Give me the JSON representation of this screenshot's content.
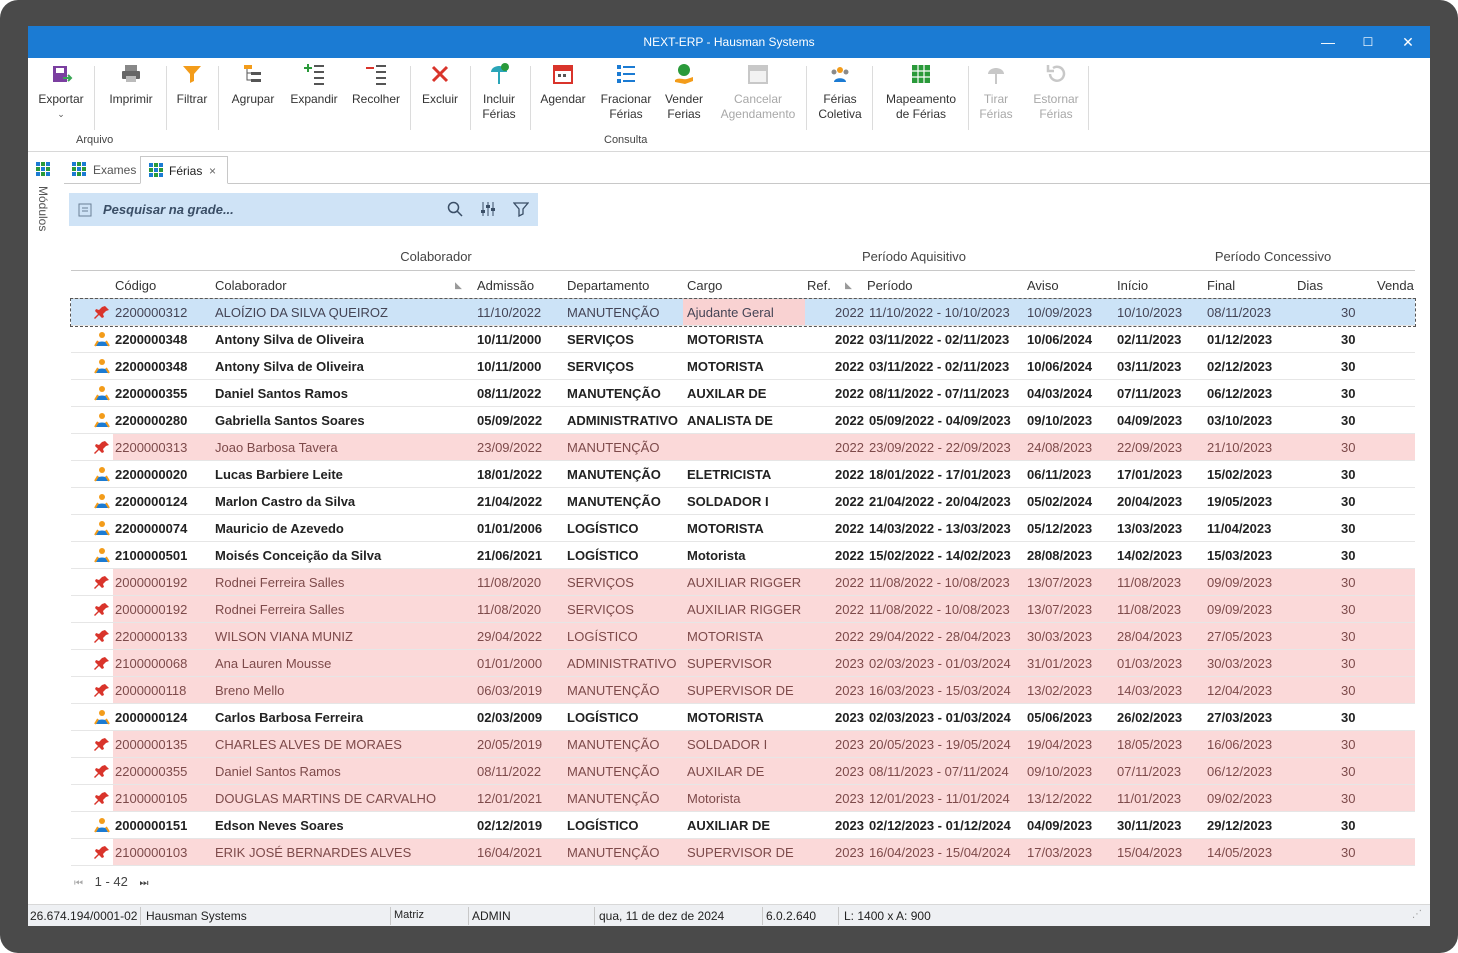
{
  "window": {
    "title": "NEXT-ERP - Hausman Systems",
    "minimize": "—",
    "maximize": "☐",
    "close": "✕"
  },
  "ribbon": {
    "exportar": "Exportar",
    "imprimir": "Imprimir",
    "filtrar": "Filtrar",
    "agrupar": "Agrupar",
    "expandir": "Expandir",
    "recolher": "Recolher",
    "excluir": "Excluir",
    "incluir_ferias": [
      "Incluir",
      "Férias"
    ],
    "agendar": "Agendar",
    "fracionar_ferias": [
      "Fracionar",
      "Férias"
    ],
    "vender_ferias": [
      "Vender",
      "Ferias"
    ],
    "cancelar_agendamento": [
      "Cancelar",
      "Agendamento"
    ],
    "ferias_coletiva": [
      "Férias",
      "Coletiva"
    ],
    "mapeamento_ferias": [
      "Mapeamento",
      "de Férias"
    ],
    "tirar_ferias": [
      "Tirar",
      "Férias"
    ],
    "estornar_ferias": [
      "Estornar",
      "Férias"
    ],
    "group_arquivo": "Arquivo",
    "group_consulta": "Consulta"
  },
  "sidebar": {
    "label": "Módulos"
  },
  "tabs": [
    {
      "label": "Exames"
    },
    {
      "label": "Férias",
      "close": "×"
    }
  ],
  "search": {
    "placeholder": "Pesquisar na grade..."
  },
  "bands": {
    "colaborador": "Colaborador",
    "periodo_aquisitivo": "Período Aquisitivo",
    "periodo_concessivo": "Período Concessivo"
  },
  "columns": {
    "codigo": "Código",
    "colaborador": "Colaborador",
    "admissao": "Admissão",
    "departamento": "Departamento",
    "cargo": "Cargo",
    "ref": "Ref.",
    "periodo": "Período",
    "aviso": "Aviso",
    "inicio": "Início",
    "final": "Final",
    "dias": "Dias",
    "venda": "Venda"
  },
  "rows": [
    {
      "status": "selected",
      "codigo": "2200000312",
      "colaborador": "ALOÍZIO DA SILVA QUEIROZ",
      "admissao": "11/10/2022",
      "departamento": "MANUTENÇÃO",
      "cargo": "Ajudante Geral",
      "ref": "2022",
      "periodo": "11/10/2022 - 10/10/2023",
      "aviso": "10/09/2023",
      "inicio": "10/10/2023",
      "final": "08/11/2023",
      "dias": "30"
    },
    {
      "status": "active",
      "codigo": "2200000348",
      "colaborador": "Antony Silva de Oliveira",
      "admissao": "10/11/2000",
      "departamento": "SERVIÇOS",
      "cargo": "MOTORISTA",
      "ref": "2022",
      "periodo": "03/11/2022 - 02/11/2023",
      "aviso": "10/06/2024",
      "inicio": "02/11/2023",
      "final": "01/12/2023",
      "dias": "30"
    },
    {
      "status": "active",
      "codigo": "2200000348",
      "colaborador": "Antony Silva de Oliveira",
      "admissao": "10/11/2000",
      "departamento": "SERVIÇOS",
      "cargo": "MOTORISTA",
      "ref": "2022",
      "periodo": "03/11/2022 - 02/11/2023",
      "aviso": "10/06/2024",
      "inicio": "03/11/2023",
      "final": "02/12/2023",
      "dias": "30"
    },
    {
      "status": "active",
      "codigo": "2200000355",
      "colaborador": "Daniel Santos Ramos",
      "admissao": "08/11/2022",
      "departamento": "MANUTENÇÃO",
      "cargo": "AUXILAR DE",
      "ref": "2022",
      "periodo": "08/11/2022 - 07/11/2023",
      "aviso": "04/03/2024",
      "inicio": "07/11/2023",
      "final": "06/12/2023",
      "dias": "30"
    },
    {
      "status": "active",
      "codigo": "2200000280",
      "colaborador": "Gabriella Santos Soares",
      "admissao": "05/09/2022",
      "departamento": "ADMINISTRATIVO",
      "cargo": "ANALISTA DE",
      "ref": "2022",
      "periodo": "05/09/2022 - 04/09/2023",
      "aviso": "09/10/2023",
      "inicio": "04/09/2023",
      "final": "03/10/2023",
      "dias": "30"
    },
    {
      "status": "pending",
      "codigo": "2200000313",
      "colaborador": "Joao Barbosa Tavera",
      "admissao": "23/09/2022",
      "departamento": "MANUTENÇÃO",
      "cargo": "",
      "ref": "2022",
      "periodo": "23/09/2022 - 22/09/2023",
      "aviso": "24/08/2023",
      "inicio": "22/09/2023",
      "final": "21/10/2023",
      "dias": "30"
    },
    {
      "status": "active",
      "codigo": "2200000020",
      "colaborador": "Lucas Barbiere Leite",
      "admissao": "18/01/2022",
      "departamento": "MANUTENÇÃO",
      "cargo": "ELETRICISTA",
      "ref": "2022",
      "periodo": "18/01/2022 - 17/01/2023",
      "aviso": "06/11/2023",
      "inicio": "17/01/2023",
      "final": "15/02/2023",
      "dias": "30"
    },
    {
      "status": "active",
      "codigo": "2200000124",
      "colaborador": "Marlon Castro da Silva",
      "admissao": "21/04/2022",
      "departamento": "MANUTENÇÃO",
      "cargo": "SOLDADOR I",
      "ref": "2022",
      "periodo": "21/04/2022 - 20/04/2023",
      "aviso": "05/02/2024",
      "inicio": "20/04/2023",
      "final": "19/05/2023",
      "dias": "30"
    },
    {
      "status": "active",
      "codigo": "2200000074",
      "colaborador": "Mauricio de Azevedo",
      "admissao": "01/01/2006",
      "departamento": "LOGÍSTICO",
      "cargo": "MOTORISTA",
      "ref": "2022",
      "periodo": "14/03/2022 - 13/03/2023",
      "aviso": "05/12/2023",
      "inicio": "13/03/2023",
      "final": "11/04/2023",
      "dias": "30"
    },
    {
      "status": "active",
      "codigo": "2100000501",
      "colaborador": "Moisés Conceição da Silva",
      "admissao": "21/06/2021",
      "departamento": "LOGÍSTICO",
      "cargo": "Motorista",
      "ref": "2022",
      "periodo": "15/02/2022 - 14/02/2023",
      "aviso": "28/08/2023",
      "inicio": "14/02/2023",
      "final": "15/03/2023",
      "dias": "30"
    },
    {
      "status": "pending",
      "codigo": "2000000192",
      "colaborador": "Rodnei Ferreira Salles",
      "admissao": "11/08/2020",
      "departamento": "SERVIÇOS",
      "cargo": "AUXILIAR RIGGER",
      "ref": "2022",
      "periodo": "11/08/2022 - 10/08/2023",
      "aviso": "13/07/2023",
      "inicio": "11/08/2023",
      "final": "09/09/2023",
      "dias": "30"
    },
    {
      "status": "pending",
      "codigo": "2000000192",
      "colaborador": "Rodnei Ferreira Salles",
      "admissao": "11/08/2020",
      "departamento": "SERVIÇOS",
      "cargo": "AUXILIAR RIGGER",
      "ref": "2022",
      "periodo": "11/08/2022 - 10/08/2023",
      "aviso": "13/07/2023",
      "inicio": "11/08/2023",
      "final": "09/09/2023",
      "dias": "30"
    },
    {
      "status": "pending",
      "codigo": "2200000133",
      "colaborador": "WILSON VIANA MUNIZ",
      "admissao": "29/04/2022",
      "departamento": "LOGÍSTICO",
      "cargo": "MOTORISTA",
      "ref": "2022",
      "periodo": "29/04/2022 - 28/04/2023",
      "aviso": "30/03/2023",
      "inicio": "28/04/2023",
      "final": "27/05/2023",
      "dias": "30"
    },
    {
      "status": "pending",
      "codigo": "2100000068",
      "colaborador": "Ana Lauren Mousse",
      "admissao": "01/01/2000",
      "departamento": "ADMINISTRATIVO",
      "cargo": "SUPERVISOR",
      "ref": "2023",
      "periodo": "02/03/2023 - 01/03/2024",
      "aviso": "31/01/2023",
      "inicio": "01/03/2023",
      "final": "30/03/2023",
      "dias": "30"
    },
    {
      "status": "pending",
      "codigo": "2000000118",
      "colaborador": "Breno Mello",
      "admissao": "06/03/2019",
      "departamento": "MANUTENÇÃO",
      "cargo": "SUPERVISOR DE",
      "ref": "2023",
      "periodo": "16/03/2023 - 15/03/2024",
      "aviso": "13/02/2023",
      "inicio": "14/03/2023",
      "final": "12/04/2023",
      "dias": "30"
    },
    {
      "status": "active",
      "codigo": "2000000124",
      "colaborador": "Carlos Barbosa Ferreira",
      "admissao": "02/03/2009",
      "departamento": "LOGÍSTICO",
      "cargo": "MOTORISTA",
      "ref": "2023",
      "periodo": "02/03/2023 - 01/03/2024",
      "aviso": "05/06/2023",
      "inicio": "26/02/2023",
      "final": "27/03/2023",
      "dias": "30"
    },
    {
      "status": "pending",
      "codigo": "2000000135",
      "colaborador": "CHARLES ALVES DE MORAES",
      "admissao": "20/05/2019",
      "departamento": "MANUTENÇÃO",
      "cargo": "SOLDADOR I",
      "ref": "2023",
      "periodo": "20/05/2023 - 19/05/2024",
      "aviso": "19/04/2023",
      "inicio": "18/05/2023",
      "final": "16/06/2023",
      "dias": "30"
    },
    {
      "status": "pending",
      "codigo": "2200000355",
      "colaborador": "Daniel Santos Ramos",
      "admissao": "08/11/2022",
      "departamento": "MANUTENÇÃO",
      "cargo": "AUXILAR DE",
      "ref": "2023",
      "periodo": "08/11/2023 - 07/11/2024",
      "aviso": "09/10/2023",
      "inicio": "07/11/2023",
      "final": "06/12/2023",
      "dias": "30"
    },
    {
      "status": "pending",
      "codigo": "2100000105",
      "colaborador": "DOUGLAS MARTINS DE CARVALHO",
      "admissao": "12/01/2021",
      "departamento": "MANUTENÇÃO",
      "cargo": "Motorista",
      "ref": "2023",
      "periodo": "12/01/2023 - 11/01/2024",
      "aviso": "13/12/2022",
      "inicio": "11/01/2023",
      "final": "09/02/2023",
      "dias": "30"
    },
    {
      "status": "active",
      "codigo": "2000000151",
      "colaborador": "Edson Neves Soares",
      "admissao": "02/12/2019",
      "departamento": "LOGÍSTICO",
      "cargo": "AUXILIAR DE",
      "ref": "2023",
      "periodo": "02/12/2023 - 01/12/2024",
      "aviso": "04/09/2023",
      "inicio": "30/11/2023",
      "final": "29/12/2023",
      "dias": "30"
    },
    {
      "status": "pending",
      "codigo": "2100000103",
      "colaborador": "ERIK JOSÉ BERNARDES ALVES",
      "admissao": "16/04/2021",
      "departamento": "MANUTENÇÃO",
      "cargo": "SUPERVISOR DE",
      "ref": "2023",
      "periodo": "16/04/2023 - 15/04/2024",
      "aviso": "17/03/2023",
      "inicio": "15/04/2023",
      "final": "14/05/2023",
      "dias": "30"
    }
  ],
  "pager": {
    "first": "⏮",
    "range": "1 - 42",
    "last": "⏭"
  },
  "statusbar": {
    "cnpj": "26.674.194/0001-02",
    "company": "Hausman Systems",
    "branch": "Matriz",
    "user": "ADMIN",
    "date": "qua, 11 de dez de 2024",
    "version": "6.0.2.640",
    "resolution": "L: 1400 x A: 900"
  },
  "colors": {
    "titlebar": "#1b7bd3",
    "pending_row": "#fbd9d9",
    "selected_row": "#cce3f7",
    "search_bg": "#cfe3f6"
  }
}
